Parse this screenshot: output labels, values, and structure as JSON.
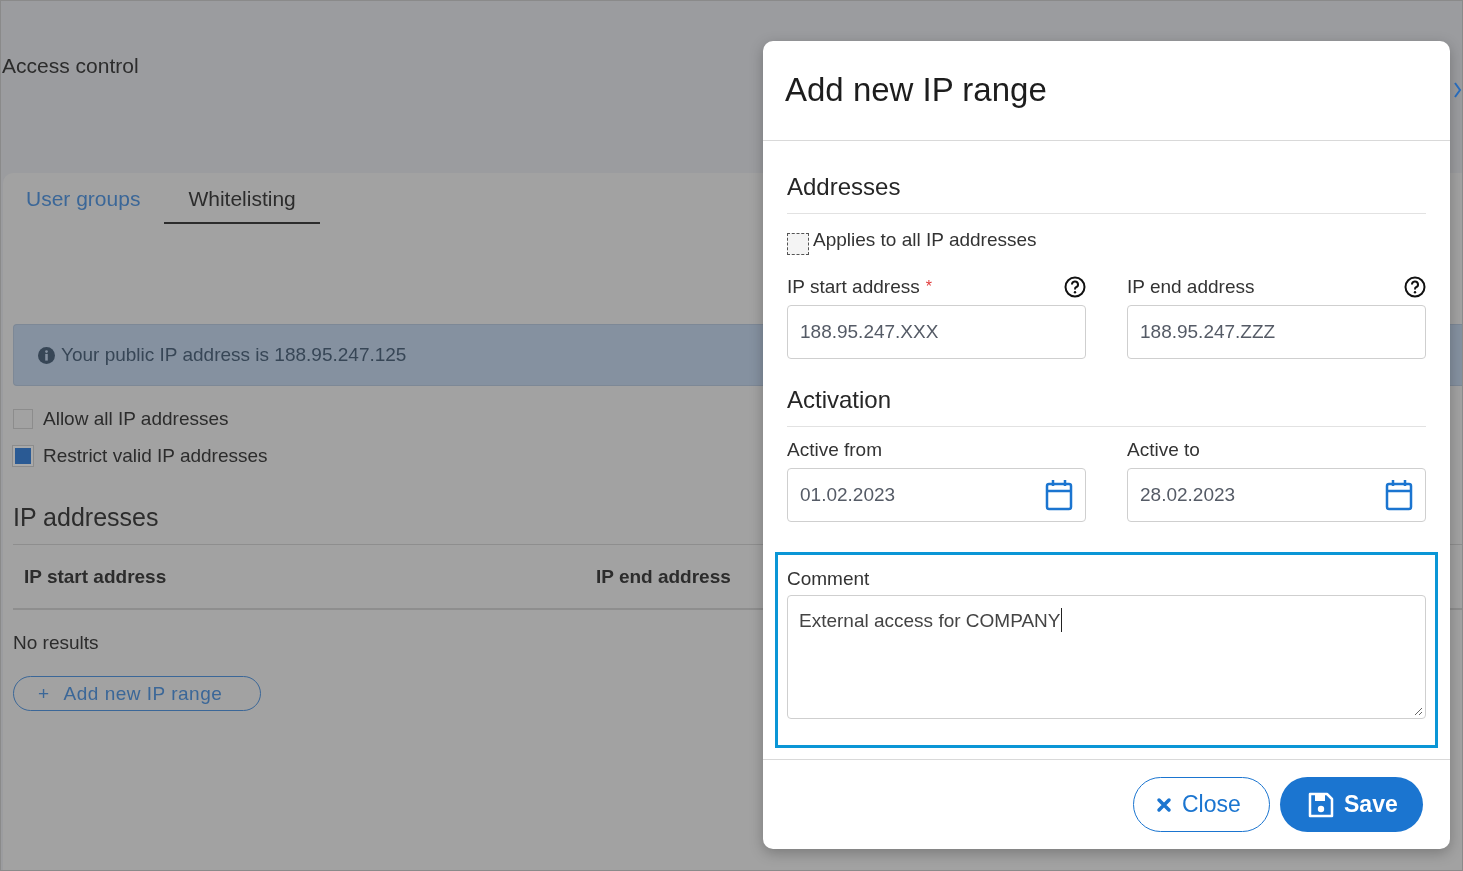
{
  "page": {
    "title": "Access control",
    "tabs": [
      {
        "label": "User groups",
        "selected": false
      },
      {
        "label": "Whitelisting",
        "selected": true
      }
    ],
    "info": "Your public IP address is 188.95.247.125",
    "options": [
      {
        "label": "Allow all IP addresses",
        "checked": false
      },
      {
        "label": "Restrict valid IP addresses",
        "checked": true
      }
    ],
    "section_title": "IP addresses",
    "table": {
      "columns": [
        "IP start address",
        "IP end address"
      ],
      "empty_text": "No results"
    },
    "add_button": {
      "icon": "+",
      "label": "Add new IP range"
    }
  },
  "dialog": {
    "title": "Add new IP range",
    "addresses_title": "Addresses",
    "applies_all": {
      "label": "Applies to all IP addresses",
      "checked": false
    },
    "address_fields": [
      {
        "label": "IP start address",
        "required_mark": "*",
        "value": "188.95.247.XXX"
      },
      {
        "label": "IP end address",
        "value": "188.95.247.ZZZ"
      }
    ],
    "activation_title": "Activation",
    "date_fields": [
      {
        "label": "Active from",
        "value": "01.02.2023"
      },
      {
        "label": "Active to",
        "value": "28.02.2023"
      }
    ],
    "comment": {
      "label": "Comment",
      "value": "External access for COMPANY",
      "focused": true
    },
    "buttons": [
      {
        "kind": "close",
        "label": "Close"
      },
      {
        "kind": "save",
        "label": "Save"
      }
    ]
  }
}
